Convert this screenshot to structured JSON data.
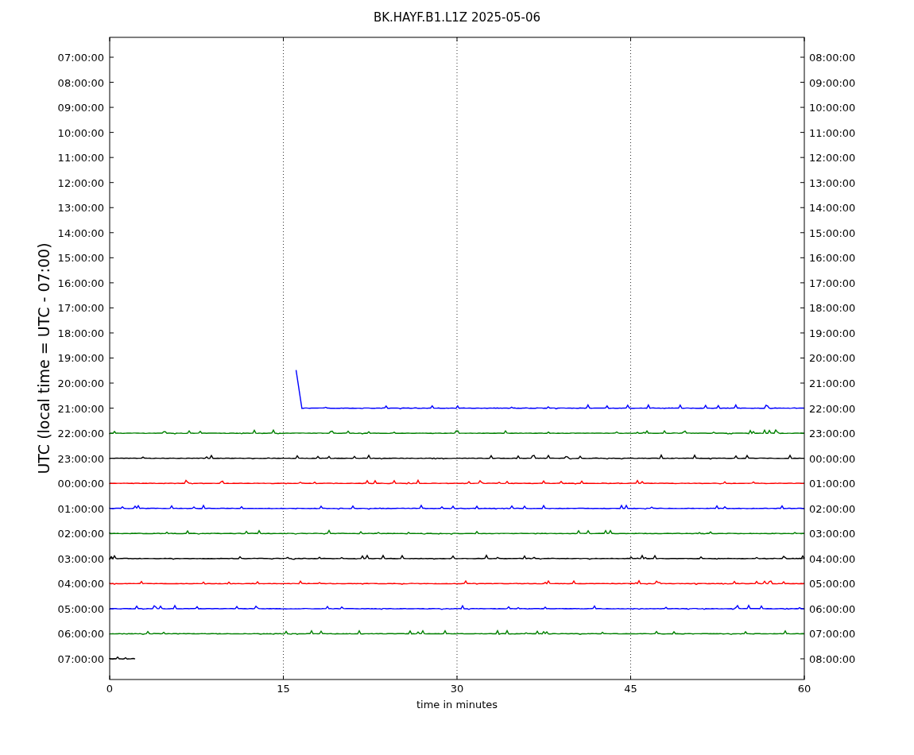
{
  "title": "BK.HAYF.B1.L1Z 2025-05-06",
  "ylabel": "UTC (local time = UTC - 07:00)",
  "xlabel": "time in minutes",
  "xticks": [
    "0",
    "15",
    "30",
    "45",
    "60"
  ],
  "rows": [
    {
      "left": "07:00:00",
      "right": "08:00:00"
    },
    {
      "left": "08:00:00",
      "right": "09:00:00"
    },
    {
      "left": "09:00:00",
      "right": "10:00:00"
    },
    {
      "left": "10:00:00",
      "right": "11:00:00"
    },
    {
      "left": "11:00:00",
      "right": "12:00:00"
    },
    {
      "left": "12:00:00",
      "right": "13:00:00"
    },
    {
      "left": "13:00:00",
      "right": "14:00:00"
    },
    {
      "left": "14:00:00",
      "right": "15:00:00"
    },
    {
      "left": "15:00:00",
      "right": "16:00:00"
    },
    {
      "left": "16:00:00",
      "right": "17:00:00"
    },
    {
      "left": "17:00:00",
      "right": "18:00:00"
    },
    {
      "left": "18:00:00",
      "right": "19:00:00"
    },
    {
      "left": "19:00:00",
      "right": "20:00:00"
    },
    {
      "left": "20:00:00",
      "right": "21:00:00"
    },
    {
      "left": "21:00:00",
      "right": "22:00:00",
      "trace": {
        "color": "#0000ff",
        "kind": "late-start"
      }
    },
    {
      "left": "22:00:00",
      "right": "23:00:00",
      "trace": {
        "color": "#008000",
        "kind": "full"
      }
    },
    {
      "left": "23:00:00",
      "right": "00:00:00",
      "trace": {
        "color": "#000000",
        "kind": "full"
      }
    },
    {
      "left": "00:00:00",
      "right": "01:00:00",
      "trace": {
        "color": "#ff0000",
        "kind": "full"
      }
    },
    {
      "left": "01:00:00",
      "right": "02:00:00",
      "trace": {
        "color": "#0000ff",
        "kind": "full"
      }
    },
    {
      "left": "02:00:00",
      "right": "03:00:00",
      "trace": {
        "color": "#008000",
        "kind": "full"
      }
    },
    {
      "left": "03:00:00",
      "right": "04:00:00",
      "trace": {
        "color": "#000000",
        "kind": "full"
      }
    },
    {
      "left": "04:00:00",
      "right": "05:00:00",
      "trace": {
        "color": "#ff0000",
        "kind": "full"
      }
    },
    {
      "left": "05:00:00",
      "right": "06:00:00",
      "trace": {
        "color": "#0000ff",
        "kind": "full"
      }
    },
    {
      "left": "06:00:00",
      "right": "07:00:00",
      "trace": {
        "color": "#008000",
        "kind": "full"
      }
    },
    {
      "left": "07:00:00",
      "right": "08:00:00",
      "trace": {
        "color": "#000000",
        "kind": "early-end"
      }
    }
  ]
}
